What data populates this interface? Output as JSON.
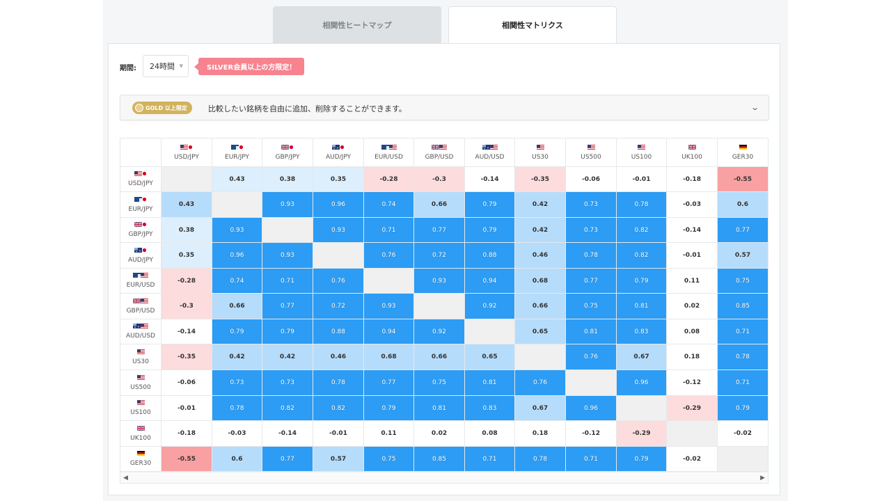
{
  "tabs": [
    {
      "label": "相関性ヒートマップ",
      "active": false
    },
    {
      "label": "相関性マトリクス",
      "active": true
    }
  ],
  "period": {
    "label": "期間:",
    "value": "24時間"
  },
  "silver_note": "SILVER会員以上の方限定！",
  "gold_bar": {
    "badge": "GOLD 以上限定",
    "text": "比較したい銘柄を自由に追加、削除することができます。"
  },
  "colors": {
    "strong_positive": "#2c9cf4",
    "positive": "#b6dcfb",
    "weak_positive": "#ddeefc",
    "strong_negative": "#f8a0a2",
    "weak_negative": "#fcdcdc",
    "diagonal": "#f0f0f0"
  },
  "symbols": [
    {
      "name": "USD/JPY",
      "flags": [
        "us",
        "jp"
      ]
    },
    {
      "name": "EUR/JPY",
      "flags": [
        "eu",
        "jp"
      ]
    },
    {
      "name": "GBP/JPY",
      "flags": [
        "gb",
        "jp"
      ]
    },
    {
      "name": "AUD/JPY",
      "flags": [
        "au",
        "jp"
      ]
    },
    {
      "name": "EUR/USD",
      "flags": [
        "eu",
        "us"
      ]
    },
    {
      "name": "GBP/USD",
      "flags": [
        "gb",
        "us"
      ]
    },
    {
      "name": "AUD/USD",
      "flags": [
        "au",
        "us"
      ]
    },
    {
      "name": "US30",
      "flags": [
        "us"
      ]
    },
    {
      "name": "US500",
      "flags": [
        "us"
      ]
    },
    {
      "name": "US100",
      "flags": [
        "us"
      ]
    },
    {
      "name": "UK100",
      "flags": [
        "gb"
      ]
    },
    {
      "name": "GER30",
      "flags": [
        "de"
      ]
    }
  ],
  "matrix": [
    [
      null,
      0.43,
      0.38,
      0.35,
      -0.28,
      -0.3,
      -0.14,
      -0.35,
      -0.06,
      -0.01,
      -0.18,
      -0.55
    ],
    [
      0.43,
      null,
      0.93,
      0.96,
      0.74,
      0.66,
      0.79,
      0.42,
      0.73,
      0.78,
      -0.03,
      0.6
    ],
    [
      0.38,
      0.93,
      null,
      0.93,
      0.71,
      0.77,
      0.79,
      0.42,
      0.73,
      0.82,
      -0.14,
      0.77
    ],
    [
      0.35,
      0.96,
      0.93,
      null,
      0.76,
      0.72,
      0.88,
      0.46,
      0.78,
      0.82,
      -0.01,
      0.57
    ],
    [
      -0.28,
      0.74,
      0.71,
      0.76,
      null,
      0.93,
      0.94,
      0.68,
      0.77,
      0.79,
      0.11,
      0.75
    ],
    [
      -0.3,
      0.66,
      0.77,
      0.72,
      0.93,
      null,
      0.92,
      0.66,
      0.75,
      0.81,
      0.02,
      0.85
    ],
    [
      -0.14,
      0.79,
      0.79,
      0.88,
      0.94,
      0.92,
      null,
      0.65,
      0.81,
      0.83,
      0.08,
      0.71
    ],
    [
      -0.35,
      0.42,
      0.42,
      0.46,
      0.68,
      0.66,
      0.65,
      null,
      0.76,
      0.67,
      0.18,
      0.78
    ],
    [
      -0.06,
      0.73,
      0.73,
      0.78,
      0.77,
      0.75,
      0.81,
      0.76,
      null,
      0.96,
      -0.12,
      0.71
    ],
    [
      -0.01,
      0.78,
      0.82,
      0.82,
      0.79,
      0.81,
      0.83,
      0.67,
      0.96,
      null,
      -0.29,
      0.79
    ],
    [
      -0.18,
      -0.03,
      -0.14,
      -0.01,
      0.11,
      0.02,
      0.08,
      0.18,
      -0.12,
      -0.29,
      null,
      -0.02
    ],
    [
      -0.55,
      0.6,
      0.77,
      0.57,
      0.75,
      0.85,
      0.71,
      0.78,
      0.71,
      0.79,
      -0.02,
      null
    ]
  ],
  "matrix_styles": [
    [
      "diag",
      "vlblue",
      "vlblue",
      "vlblue",
      "lred",
      "lred",
      "white",
      "lred",
      "white",
      "white",
      "white",
      "red"
    ],
    [
      "lblue",
      "diag",
      "blue",
      "blue",
      "blue",
      "lblue",
      "blue",
      "lblue",
      "blue",
      "blue",
      "white",
      "lblue"
    ],
    [
      "vlblue",
      "blue",
      "diag",
      "blue",
      "blue",
      "blue",
      "blue",
      "lblue",
      "blue",
      "blue",
      "white",
      "blue"
    ],
    [
      "vlblue",
      "blue",
      "blue",
      "diag",
      "blue",
      "blue",
      "blue",
      "lblue",
      "blue",
      "blue",
      "white",
      "lblue"
    ],
    [
      "lred",
      "blue",
      "blue",
      "blue",
      "diag",
      "blue",
      "blue",
      "lblue",
      "blue",
      "blue",
      "white",
      "blue"
    ],
    [
      "lred",
      "lblue",
      "blue",
      "blue",
      "blue",
      "diag",
      "blue",
      "lblue",
      "blue",
      "blue",
      "white",
      "blue"
    ],
    [
      "white",
      "blue",
      "blue",
      "blue",
      "blue",
      "blue",
      "diag",
      "lblue",
      "blue",
      "blue",
      "white",
      "blue"
    ],
    [
      "lred",
      "lblue",
      "lblue",
      "lblue",
      "lblue",
      "lblue",
      "lblue",
      "diag",
      "blue",
      "lblue",
      "white",
      "blue"
    ],
    [
      "white",
      "blue",
      "blue",
      "blue",
      "blue",
      "blue",
      "blue",
      "blue",
      "diag",
      "blue",
      "white",
      "blue"
    ],
    [
      "white",
      "blue",
      "blue",
      "blue",
      "blue",
      "blue",
      "blue",
      "lblue",
      "blue",
      "diag",
      "lred",
      "blue"
    ],
    [
      "white",
      "white",
      "white",
      "white",
      "white",
      "white",
      "white",
      "white",
      "white",
      "lred",
      "diag",
      "white"
    ],
    [
      "red",
      "lblue",
      "blue",
      "lblue",
      "blue",
      "blue",
      "blue",
      "blue",
      "blue",
      "blue",
      "white",
      "diag"
    ]
  ],
  "scroll": {
    "left_icon": "◀",
    "right_icon": "▶"
  }
}
